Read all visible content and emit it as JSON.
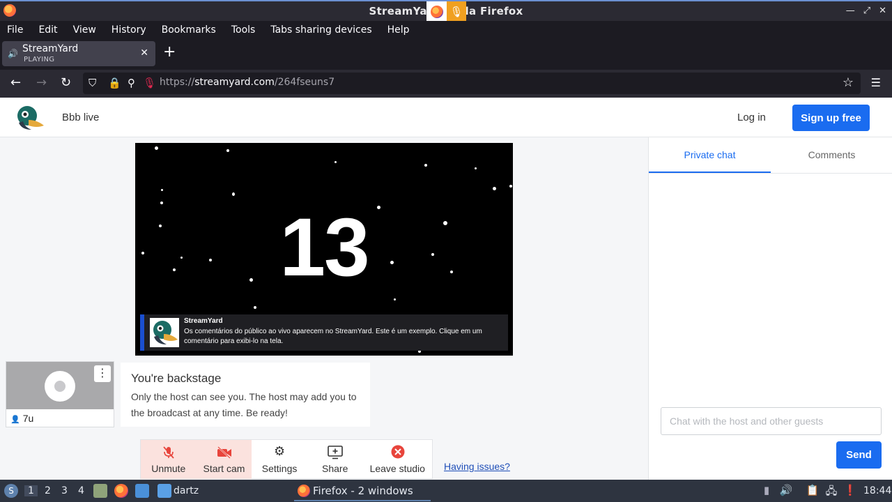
{
  "window": {
    "title": "StreamYard — Mozilla Firefox",
    "title_visible": "StreamYard  ozilla Firefox"
  },
  "menubar": {
    "items": [
      "File",
      "Edit",
      "View",
      "History",
      "Bookmarks",
      "Tools",
      "Tabs sharing devices",
      "Help"
    ]
  },
  "tab": {
    "title": "StreamYard",
    "subtitle": "PLAYING",
    "close": "✕"
  },
  "navbar": {
    "url_scheme": "https://",
    "url_host": "streamyard.com",
    "url_path": "/264fseuns7"
  },
  "site": {
    "broadcast_title": "Bbb live",
    "login_label": "Log in",
    "signup_label": "Sign up free"
  },
  "stage": {
    "countdown": "13",
    "banner_name": "StreamYard",
    "banner_text": "Os comentários do público ao vivo aparecem no StreamYard. Este é um exemplo. Clique em um comentário para exibi-lo na tela."
  },
  "participant": {
    "name": "7u"
  },
  "backstage": {
    "heading": "You're backstage",
    "body": "Only the host can see you. The host may add you to the broadcast at any time. Be ready!"
  },
  "toolbar": {
    "unmute": "Unmute",
    "start_cam": "Start cam",
    "settings": "Settings",
    "share": "Share",
    "leave": "Leave studio",
    "having_issues": "Having issues?"
  },
  "chat": {
    "tab_private": "Private chat",
    "tab_comments": "Comments",
    "placeholder": "Chat with the host and other guests",
    "send_label": "Send"
  },
  "taskbar": {
    "workspaces": [
      "1",
      "2",
      "3",
      "4"
    ],
    "folder_label": "dartz",
    "window_label": "Firefox - 2 windows",
    "clock": "18:44"
  },
  "colors": {
    "accent_blue": "#1a6cf0",
    "danger_bg": "#fbe2de",
    "danger_icon": "#e8453c",
    "browser_chrome": "#2b2a33"
  }
}
